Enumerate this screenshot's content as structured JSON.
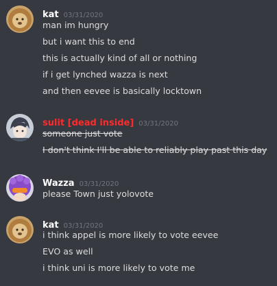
{
  "messages": [
    {
      "author": "kat",
      "author_color": "#ffffff",
      "avatar": "lion-avatar",
      "timestamp": "03/31/2020",
      "lines": [
        "man im hungry",
        "but i want this to end",
        "this is actually kind of all or nothing",
        "if i get lynched wazza is next",
        "and then eevee is basically locktown"
      ]
    },
    {
      "author": "sulit [dead inside]",
      "author_color": "#ff2a2a",
      "avatar": "anime-character-avatar",
      "timestamp": "03/31/2020",
      "lines": [
        "someone just vote",
        "I don't think I'll be able to reliably play past this day"
      ],
      "strikethrough": true
    },
    {
      "author": "Wazza",
      "author_color": "#ffffff",
      "avatar": "purple-character-avatar",
      "timestamp": "03/31/2020",
      "lines": [
        "please Town just yolovote"
      ]
    },
    {
      "author": "kat",
      "author_color": "#ffffff",
      "avatar": "lion-avatar",
      "timestamp": "03/31/2020",
      "lines": [
        "i think appel is more likely to vote eevee",
        "EVO as well",
        "i think uni is more likely to vote me"
      ]
    }
  ]
}
